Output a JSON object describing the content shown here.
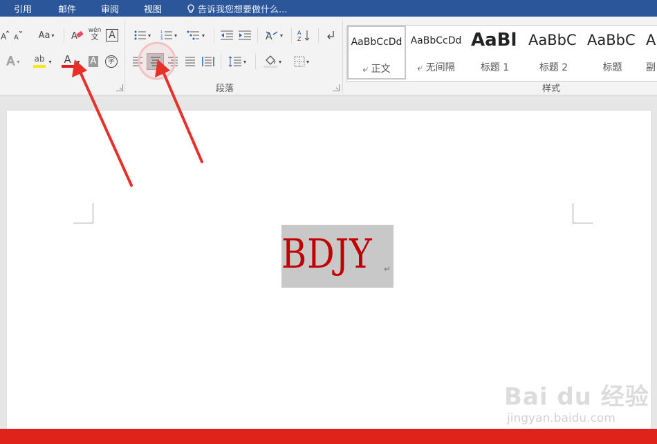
{
  "menu": {
    "tabs": [
      "引用",
      "邮件",
      "审阅",
      "视图"
    ],
    "tell_me": "告诉我您想要做什么..."
  },
  "ribbon": {
    "font": {
      "change_case_label": "Aa",
      "phonetic_top": "wén",
      "phonetic_bottom": "文",
      "char_border_label": "A",
      "text_effects_label": "A",
      "highlight_label": "ab",
      "font_color_label": "A",
      "char_shading_label": "A",
      "enclose_label": "字",
      "font_color": "#e02020",
      "highlight_color": "#f5e51e"
    },
    "paragraph": {
      "group_label": "段落"
    },
    "styles": {
      "group_label": "样式",
      "items": [
        {
          "preview": "AaBbCcDd",
          "name": "正文",
          "selected": true
        },
        {
          "preview": "AaBbCcDd",
          "name": "无间隔",
          "selected": false
        },
        {
          "preview": "AaBl",
          "name": "标题 1",
          "selected": false
        },
        {
          "preview": "AaBbC",
          "name": "标题 2",
          "selected": false
        },
        {
          "preview": "AaBbC",
          "name": "标题",
          "selected": false
        },
        {
          "preview": "A",
          "name": "副",
          "selected": false
        }
      ]
    }
  },
  "document": {
    "text": "BDJY",
    "paragraph_mark": "↵",
    "text_color": "#c00000",
    "selection_color": "#c8c8c8"
  },
  "watermark": {
    "brand": "Bai du 经验",
    "url": "jingyan.baidu.com"
  },
  "colors": {
    "menubar": "#2b579a",
    "arrow": "#e8302a",
    "bottom_bar": "#e0231a"
  }
}
